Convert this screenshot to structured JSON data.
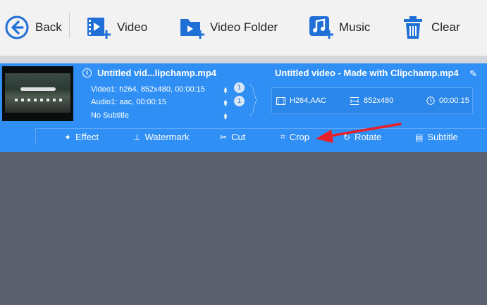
{
  "toolbar": {
    "back": "Back",
    "video": "Video",
    "video_folder": "Video Folder",
    "music": "Music",
    "clear": "Clear"
  },
  "item": {
    "source_title": "Untitled vid...lipchamp.mp4",
    "video_track": "Video1: h264, 852x480, 00:00:15",
    "audio_track": "Audio1: aac, 00:00:15",
    "subtitle_track": "No Subtitle",
    "video_badge": "1",
    "audio_badge": "1",
    "output_title": "Untitled video - Made with Clipchamp.mp4",
    "output_codec": "H264,AAC",
    "output_resolution": "852x480",
    "output_duration": "00:00:15"
  },
  "tools": {
    "effect": "Effect",
    "watermark": "Watermark",
    "cut": "Cut",
    "crop": "Crop",
    "rotate": "Rotate",
    "subtitle": "Subtitle"
  },
  "colors": {
    "panel_blue": "#2f8ff4",
    "toolbar_icon_blue": "#1f6fd6",
    "annotation_red": "#e8202a",
    "canvas_gray": "#5c6170"
  }
}
